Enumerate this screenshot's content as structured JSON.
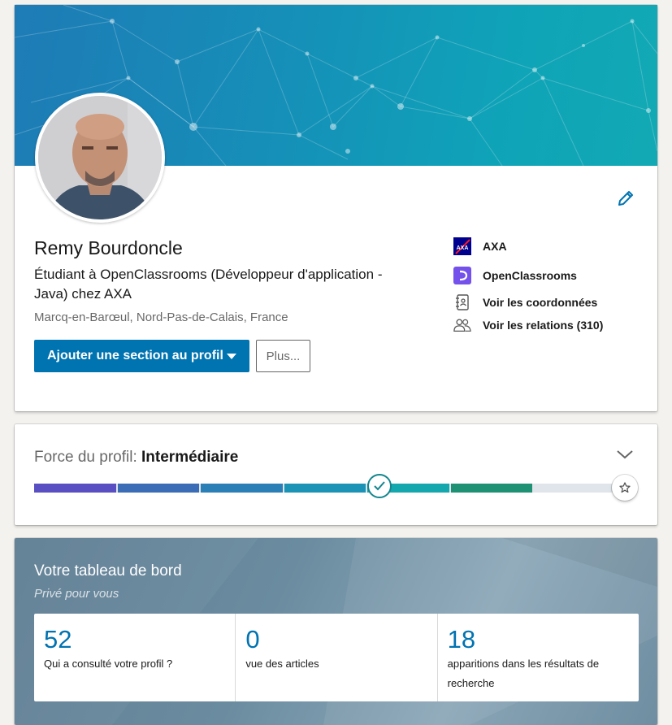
{
  "profile": {
    "name": "Remy Bourdoncle",
    "headline": "Étudiant à OpenClassrooms (Développeur d'application - Java) chez AXA",
    "location": "Marcq-en-Barœul, Nord-Pas-de-Calais, France",
    "add_section_label": "Ajouter une section au profil",
    "more_label": "Plus...",
    "side_links": {
      "company": "AXA",
      "school": "OpenClassrooms",
      "contact_info": "Voir les coordonnées",
      "connections": "Voir les relations (310)"
    },
    "icons": {
      "edit": "pencil-icon",
      "company_logo": "axa-logo",
      "school_logo": "openclassrooms-logo",
      "contact": "address-book-icon",
      "connections": "people-icon"
    }
  },
  "strength": {
    "label": "Force du profil:",
    "level": "Intermédiaire",
    "progress_fraction": 0.58,
    "icons": {
      "toggle": "chevron-down-icon",
      "current": "check-icon",
      "goal": "star-icon"
    }
  },
  "dashboard": {
    "title": "Votre tableau de bord",
    "subtitle": "Privé pour vous",
    "stats": [
      {
        "value": "52",
        "label": "Qui a consulté votre profil ?"
      },
      {
        "value": "0",
        "label": "vue des articles"
      },
      {
        "value": "18",
        "label": "apparitions dans les résultats de recherche"
      }
    ]
  },
  "colors": {
    "primary": "#0073b1",
    "banner_start": "#1e7bb6",
    "banner_end": "#12a9b4",
    "strength_segments": [
      "#5a4fc2",
      "#3b6db6",
      "#2a7fb6",
      "#1a93b6",
      "#14a7ad",
      "#1e9175",
      "#2a8a55"
    ]
  }
}
